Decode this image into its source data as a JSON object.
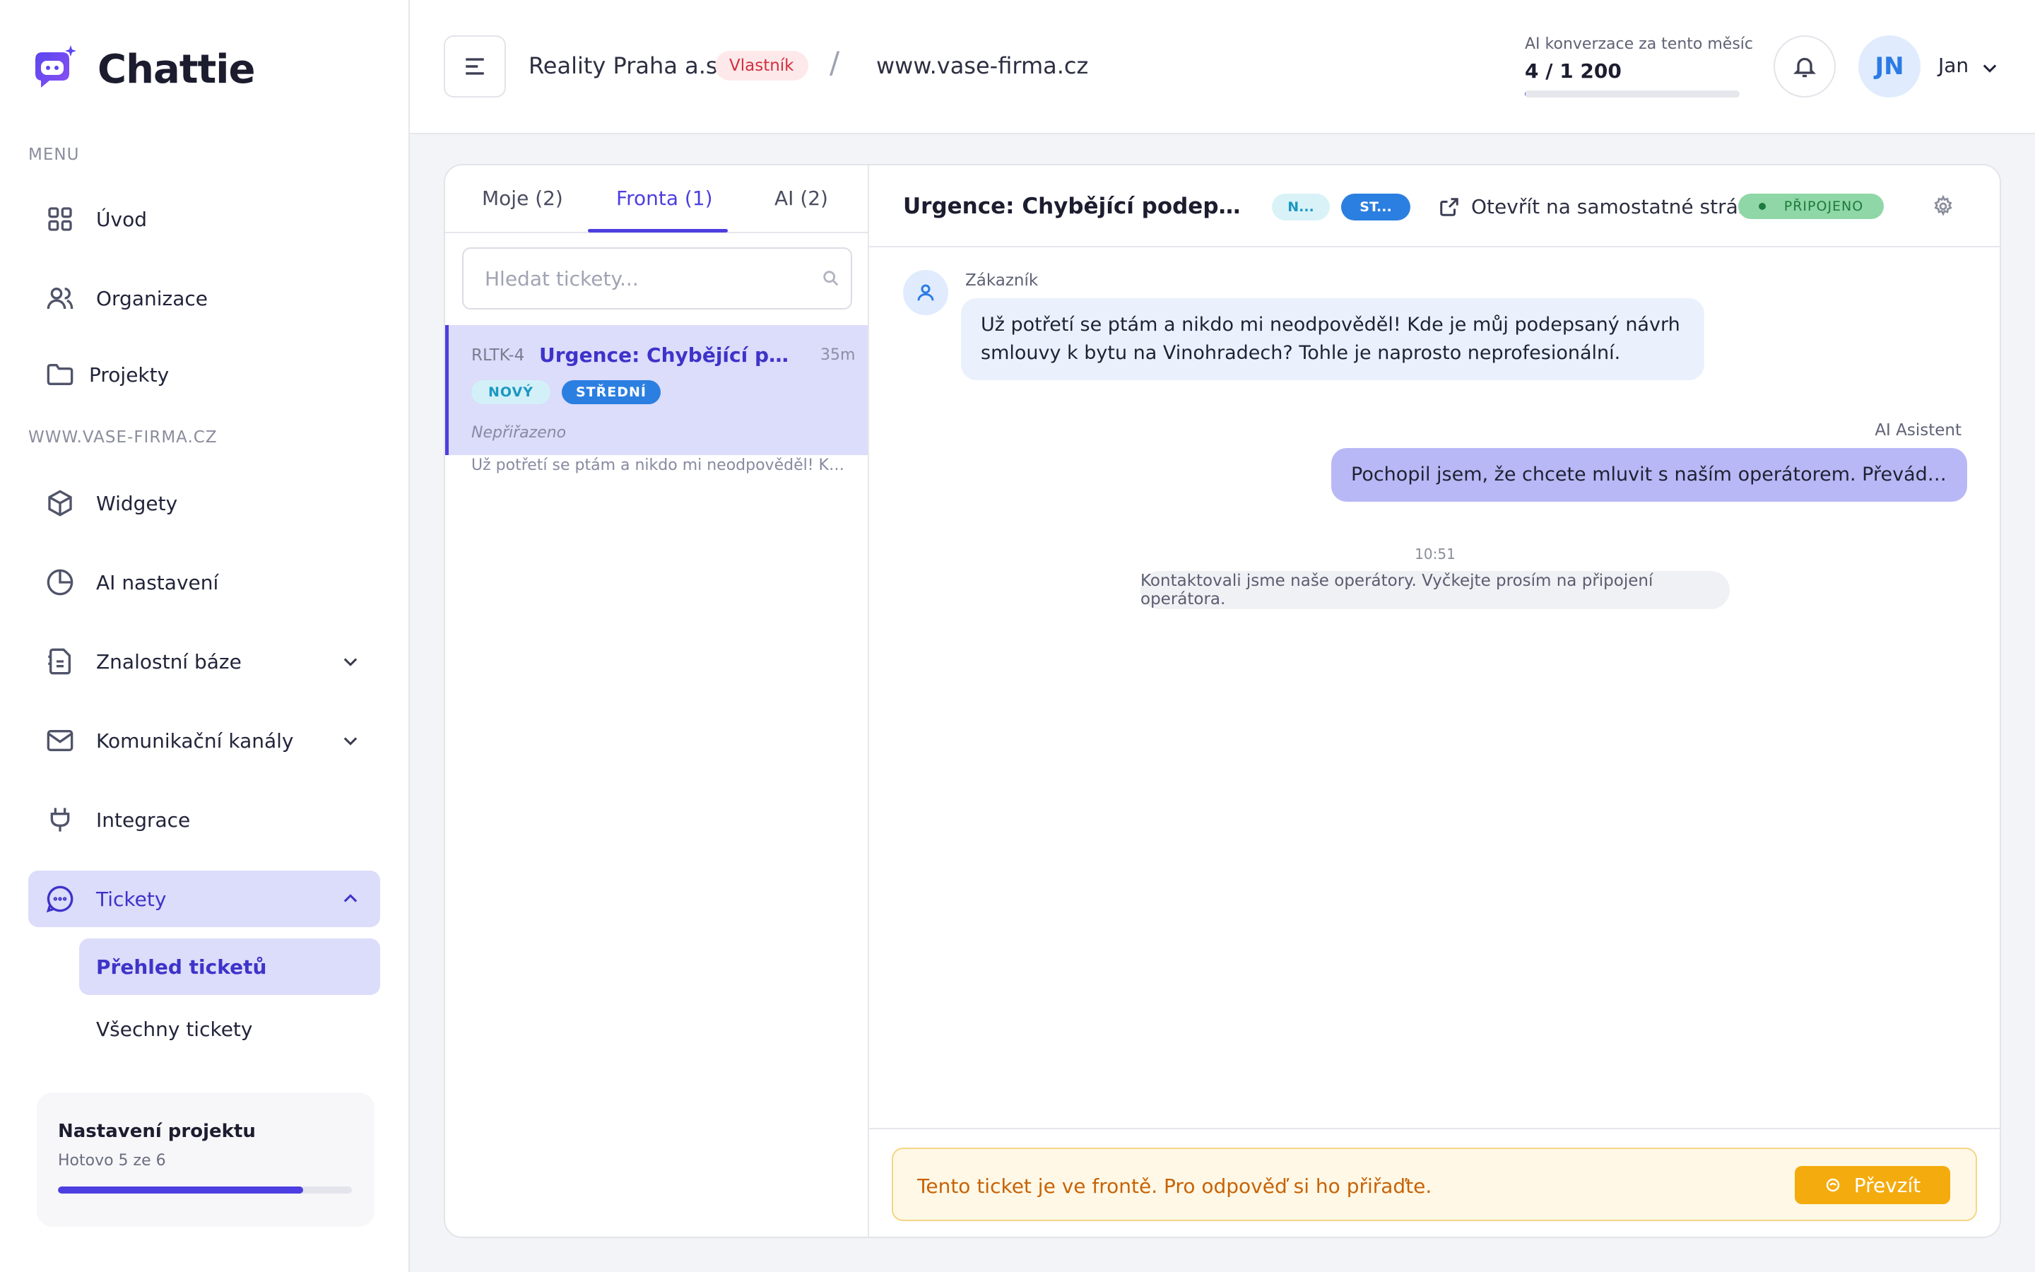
{
  "app": {
    "name": "Chattie"
  },
  "sidebar": {
    "menu_label": "MENU",
    "items_top": [
      {
        "label": "Úvod",
        "icon": "grid-icon"
      },
      {
        "label": "Organizace",
        "icon": "users-icon"
      },
      {
        "label": "Projekty",
        "icon": "folder-icon"
      }
    ],
    "project_label": "WWW.VASE-FIRMA.CZ",
    "items_project": [
      {
        "label": "Widgety",
        "icon": "cube-icon"
      },
      {
        "label": "AI nastavení",
        "icon": "pie-chart-icon"
      },
      {
        "label": "Znalostní báze",
        "icon": "document-icon"
      },
      {
        "label": "Komunikační kanály",
        "icon": "mail-icon"
      },
      {
        "label": "Integrace",
        "icon": "plug-icon"
      },
      {
        "label": "Tickety",
        "icon": "chat-bubble-icon"
      }
    ],
    "sub_items": [
      {
        "label": "Přehled ticketů"
      },
      {
        "label": "Všechny tickety"
      }
    ],
    "setup": {
      "title": "Nastavení projektu",
      "progress_text": "Hotovo 5 ze 6",
      "progress": 0.833
    }
  },
  "topbar": {
    "org_name": "Reality Praha a.s.",
    "role_badge": "Vlastník",
    "separator": "/",
    "domain": "www.vase-firma.cz",
    "usage_label": "AI konverzace za tento měsíc",
    "usage_value": "4 / 1 200",
    "usage_fraction": 0.0033,
    "user_initials": "JN",
    "user_name": "Jan"
  },
  "tickets": {
    "tabs": [
      {
        "label": "Moje (2)"
      },
      {
        "label": "Fronta (1)"
      },
      {
        "label": "AI (2)"
      }
    ],
    "search_placeholder": "Hledat tickety...",
    "list": [
      {
        "id": "RLTK-4",
        "title": "Urgence: Chybějící podepsa...",
        "time": "35m",
        "status": "NOVÝ",
        "priority": "STŘEDNÍ",
        "assignee": "Nepřiřazeno",
        "preview": "Už potřetí se ptám a nikdo mi neodpověděl! Kde ..."
      }
    ]
  },
  "chat": {
    "title": "Urgence: Chybějící podepsaný n...",
    "status_short": "N...",
    "priority_short": "ST...",
    "open_external": "Otevřít na samostatné stránce",
    "connection": "PŘIPOJENO",
    "messages": {
      "customer_label": "Zákazník",
      "customer_text": "Už potřetí se ptám a nikdo mi neodpověděl! Kde je můj podepsaný návrh smlouvy k bytu na Vinohradech? Tohle je naprosto neprofesionální.",
      "ai_label": "AI Asistent",
      "ai_text": "Pochopil jsem, že chcete mluvit s naším operátorem. Převádím vás...",
      "system_time": "10:51",
      "system_text": "Kontaktovali jsme naše operátory. Vyčkejte prosím na připojení operátora."
    },
    "queue_notice": "Tento ticket je ve frontě. Pro odpověď si ho přiřaďte.",
    "take_button": "Převzít"
  },
  "colors": {
    "accent": "#4c3ee0",
    "active_bg": "#dcdcfb",
    "owner_badge": "#d0313f",
    "connected": "#8fd7a6",
    "warning": "#f4ab0d"
  }
}
